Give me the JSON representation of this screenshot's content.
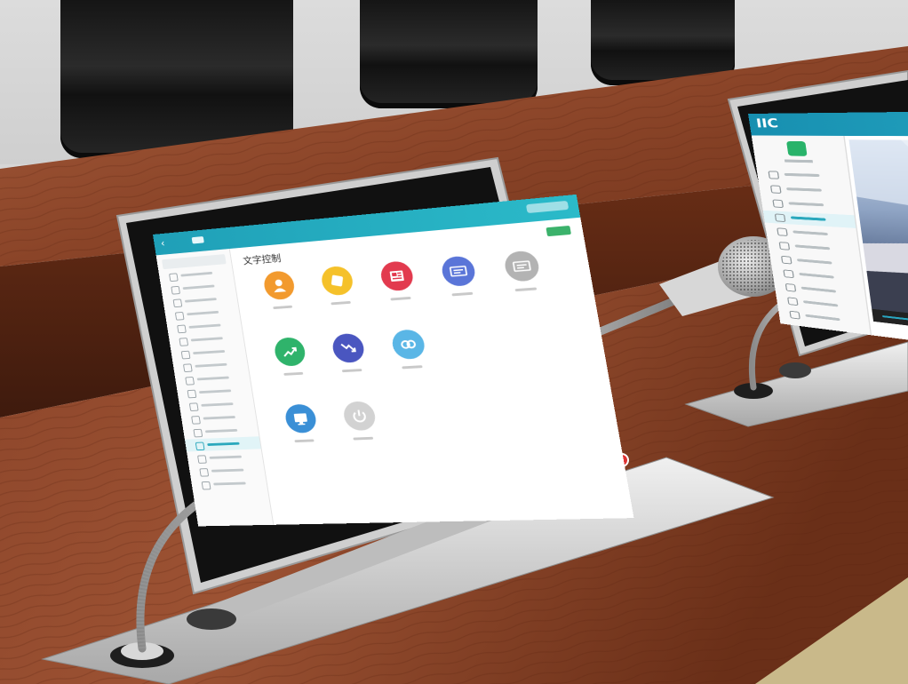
{
  "front_screen": {
    "title": "",
    "header_action": "",
    "main_title": "文字控制",
    "add_button": "",
    "sidebar": {
      "items": [
        {
          "label": "",
          "active": false
        },
        {
          "label": "",
          "active": false
        },
        {
          "label": "",
          "active": false
        },
        {
          "label": "",
          "active": false
        },
        {
          "label": "",
          "active": false
        },
        {
          "label": "",
          "active": false
        },
        {
          "label": "",
          "active": false
        },
        {
          "label": "",
          "active": false
        },
        {
          "label": "",
          "active": false
        },
        {
          "label": "",
          "active": false
        },
        {
          "label": "",
          "active": false
        },
        {
          "label": "",
          "active": false
        },
        {
          "label": "",
          "active": false
        },
        {
          "label": "",
          "active": true
        },
        {
          "label": "",
          "active": false
        },
        {
          "label": "",
          "active": false
        },
        {
          "label": "",
          "active": false
        }
      ]
    },
    "tiles": [
      {
        "label": "",
        "color": "#f29a2e",
        "icon": "user-icon"
      },
      {
        "label": "",
        "color": "#f5c12a",
        "icon": "note-icon"
      },
      {
        "label": "",
        "color": "#e23a4e",
        "icon": "newspaper-icon"
      },
      {
        "label": "",
        "color": "#5a75d8",
        "icon": "screen-icon"
      },
      {
        "label": "",
        "color": "#b3b3b3",
        "icon": "screen-icon"
      },
      {
        "label": "",
        "color": "#2fb36b",
        "icon": "trend-up-icon"
      },
      {
        "label": "",
        "color": "#4a56c0",
        "icon": "trend-down-icon"
      },
      {
        "label": "",
        "color": "#5ab6e6",
        "icon": "link-icon"
      },
      {
        "label": "",
        "color": "#3a8fd6",
        "icon": "monitor-icon"
      },
      {
        "label": "",
        "color": "#d2d2d2",
        "icon": "power-icon"
      }
    ]
  },
  "right_screen": {
    "logo": "IIC",
    "app_title": "",
    "sidebar_items": [
      {
        "label": "",
        "active": false
      },
      {
        "label": "",
        "active": false
      },
      {
        "label": "",
        "active": false
      },
      {
        "label": "",
        "active": true
      },
      {
        "label": "",
        "active": false
      },
      {
        "label": "",
        "active": false
      },
      {
        "label": "",
        "active": false
      },
      {
        "label": "",
        "active": false
      },
      {
        "label": "",
        "active": false
      },
      {
        "label": "",
        "active": false
      },
      {
        "label": "",
        "active": false
      }
    ],
    "video_progress": 0.18
  }
}
